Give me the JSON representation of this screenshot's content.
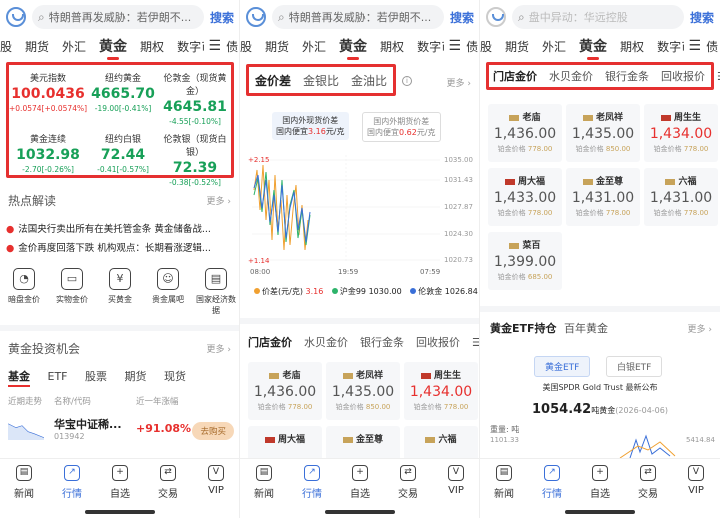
{
  "search": {
    "p1_placeholder": "特朗普再发威胁：若伊朗不...",
    "p2_placeholder": "特朗普再发威胁：若伊朗不...",
    "p3_placeholder": "盘中异动：华远控股",
    "button": "搜索"
  },
  "category_tabs": [
    "股",
    "期货",
    "外汇",
    "黄金",
    "期权",
    "数字币",
    "债"
  ],
  "quotes": [
    {
      "name": "美元指数",
      "price": "100.0436",
      "change": "+0.0574[+0.0574%]",
      "dir": "up"
    },
    {
      "name": "纽约黄金",
      "price": "4665.70",
      "change": "-19.00[-0.41%]",
      "dir": "down"
    },
    {
      "name": "伦敦金（现货黄金）",
      "price": "4645.81",
      "change": "-4.55[-0.10%]",
      "dir": "down"
    },
    {
      "name": "黄金连续",
      "price": "1032.98",
      "change": "-2.70[-0.26%]",
      "dir": "down"
    },
    {
      "name": "纽约白银",
      "price": "72.44",
      "change": "-0.41[-0.57%]",
      "dir": "down"
    },
    {
      "name": "伦敦银（现货白银）",
      "price": "72.39",
      "change": "-0.38[-0.52%]",
      "dir": "down"
    }
  ],
  "hot": {
    "title": "热点解读",
    "more": "更多",
    "news": [
      "法国央行卖出所有在美托管金条 黄金储备战...",
      "金价再度回落下跌 机构观点：长期看涨逻辑..."
    ]
  },
  "shortcuts": [
    "暗盘金价",
    "实物金价",
    "买黄金",
    "贵金属吧",
    "国家经济数据"
  ],
  "invest": {
    "title": "黄金投资机会",
    "more": "更多",
    "tabs": [
      "基金",
      "ETF",
      "股票",
      "期货",
      "现货"
    ],
    "col_trend": "近期走势",
    "col_name": "名称/代码",
    "col_change": "近一年涨幅",
    "fund_name": "华宝中证稀...",
    "fund_code": "013942",
    "fund_change": "+91.08%",
    "fund_button": "去购买"
  },
  "bottom_nav": [
    "新闻",
    "行情",
    "自选",
    "交易",
    "VIP"
  ],
  "price_tabs": [
    "金价差",
    "金银比",
    "金油比"
  ],
  "more_label": "更多",
  "premium": {
    "box1_line1": "国内外现货价差",
    "box1_line2_prefix": "国内便宜",
    "box1_value": "3.16",
    "box1_unit": "元/克",
    "box2_line1": "国内外期货价差",
    "box2_line2_prefix": "国内便宜",
    "box2_value": "0.62",
    "box2_unit": "元/克"
  },
  "chart_data": {
    "type": "line",
    "title": "",
    "x_ticks": [
      "08:00",
      "19:59",
      "07:59"
    ],
    "left_ticks": [
      "+2.15",
      "+1.14"
    ],
    "right_ticks": [
      "1035.00",
      "1031.43",
      "1027.87",
      "1024.30",
      "1020.73"
    ],
    "series": [
      {
        "name": "价差(元/克)",
        "latest": "3.16",
        "color": "#f0a030"
      },
      {
        "name": "沪金99",
        "latest": "1030.00",
        "color": "#2db36a"
      },
      {
        "name": "伦敦金",
        "latest": "1026.84",
        "color": "#3a6fd8"
      }
    ]
  },
  "store_tabs": [
    "门店金价",
    "水贝金价",
    "银行金条",
    "回收报价"
  ],
  "stores": [
    {
      "brand": "老庙",
      "price": "1,436.00",
      "label": "铂金价格",
      "sub": "778.00",
      "dir": "flat"
    },
    {
      "brand": "老凤祥",
      "price": "1,435.00",
      "label": "铂金价格",
      "sub": "850.00",
      "dir": "flat"
    },
    {
      "brand": "周生生",
      "price": "1,434.00",
      "label": "铂金价格",
      "sub": "778.00",
      "dir": "up"
    },
    {
      "brand": "周大福",
      "price": "1,433.00",
      "label": "铂金价格",
      "sub": "778.00",
      "dir": "flat"
    },
    {
      "brand": "金至尊",
      "price": "1,431.00",
      "label": "铂金价格",
      "sub": "778.00",
      "dir": "flat"
    },
    {
      "brand": "六福",
      "price": "1,431.00",
      "label": "铂金价格",
      "sub": "778.00",
      "dir": "flat"
    },
    {
      "brand": "菜百",
      "price": "1,399.00",
      "label": "铂金价格",
      "sub": "685.00",
      "dir": "flat"
    }
  ],
  "etf": {
    "title": "黄金ETF持仓",
    "title2": "百年黄金",
    "more": "更多",
    "tab1": "黄金ETF",
    "tab2": "白银ETF",
    "source": "美国SPDR Gold Trust 最新公布",
    "value": "1054.42",
    "unit": "吨黄金",
    "date": "(2026-04-06)",
    "weight_label": "重量: 吨",
    "y_top": "1101.33",
    "y_right": "5414.84"
  }
}
